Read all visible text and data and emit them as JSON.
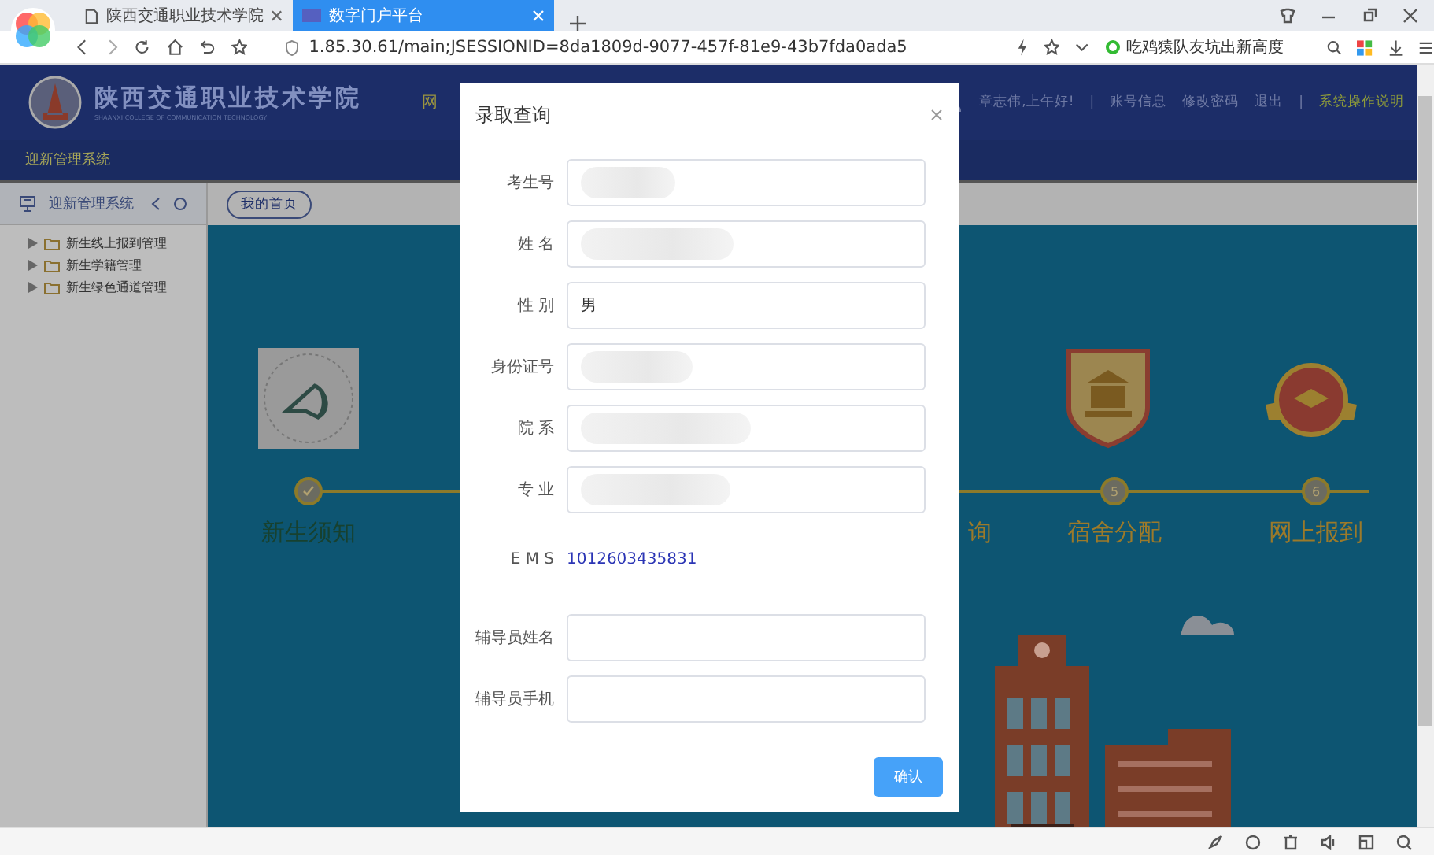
{
  "browser": {
    "tabs": [
      {
        "title": "陕西交通职业技术学院",
        "selected": false
      },
      {
        "title": "数字门户平台",
        "selected": true
      }
    ],
    "address": "1.85.30.61/main;JSESSIONID=8da1809d-9077-457f-81e9-43b7fda0ada5",
    "news": "吃鸡猿队友坑出新高度"
  },
  "header": {
    "school_name": "陕西交通职业技术学院",
    "school_name_en": "SHAANXI COLLEGE OF COMMUNICATION TECHNOLOGY",
    "nav_partial": "网",
    "greeting": "章志伟,上午好!",
    "links": [
      {
        "label": "|",
        "kind": "separator"
      },
      {
        "label": "账号信息",
        "kind": "link"
      },
      {
        "label": "修改密码",
        "kind": "link"
      },
      {
        "label": "退出",
        "kind": "link"
      },
      {
        "label": "|",
        "kind": "separator"
      },
      {
        "label": "系统操作说明",
        "kind": "highlight"
      }
    ]
  },
  "system_title": "迎新管理系统",
  "sidebar": {
    "title": "迎新管理系统",
    "items": [
      {
        "label": "新生线上报到管理",
        "expanded": false
      },
      {
        "label": "新生学籍管理",
        "expanded": false
      },
      {
        "label": "新生绿色通道管理",
        "expanded": false
      }
    ]
  },
  "page_tab": "我的首页",
  "steps": [
    {
      "kind": "done",
      "label": "新生须知"
    },
    {
      "kind": "covered",
      "label": "询"
    },
    {
      "kind": "number",
      "number": "5",
      "label": "宿舍分配"
    },
    {
      "kind": "number",
      "number": "6",
      "label": "网上报到"
    }
  ],
  "dialog": {
    "title": "录取查询",
    "fields": [
      {
        "kind": "redacted",
        "label": "考生号"
      },
      {
        "kind": "redacted",
        "label": "姓 名"
      },
      {
        "kind": "input",
        "label": "性 别",
        "value": "男"
      },
      {
        "kind": "redacted",
        "label": "身份证号"
      },
      {
        "kind": "redacted",
        "label": "院 系"
      },
      {
        "kind": "redacted",
        "label": "专 业"
      },
      {
        "kind": "text",
        "label": "E M S",
        "value": "1012603435831"
      },
      {
        "kind": "input",
        "label": "辅导员姓名"
      },
      {
        "kind": "input",
        "label": "辅导员手机"
      }
    ],
    "button": "确认"
  }
}
